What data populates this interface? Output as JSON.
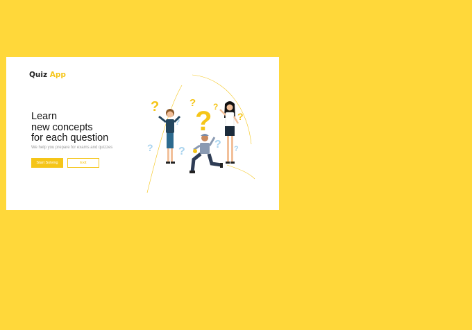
{
  "brand": {
    "prefix": "Quiz",
    "accent": "App"
  },
  "hero": {
    "line1": "Learn",
    "line2": "new concepts",
    "line3": "for each question"
  },
  "subtitle": "We help you prepare for exams and quizzes",
  "buttons": {
    "start": "Start Solving",
    "exit": "Exit"
  },
  "colors": {
    "background": "#FFD83A",
    "accent": "#F5C518",
    "question_blue": "#A9D3EE"
  }
}
